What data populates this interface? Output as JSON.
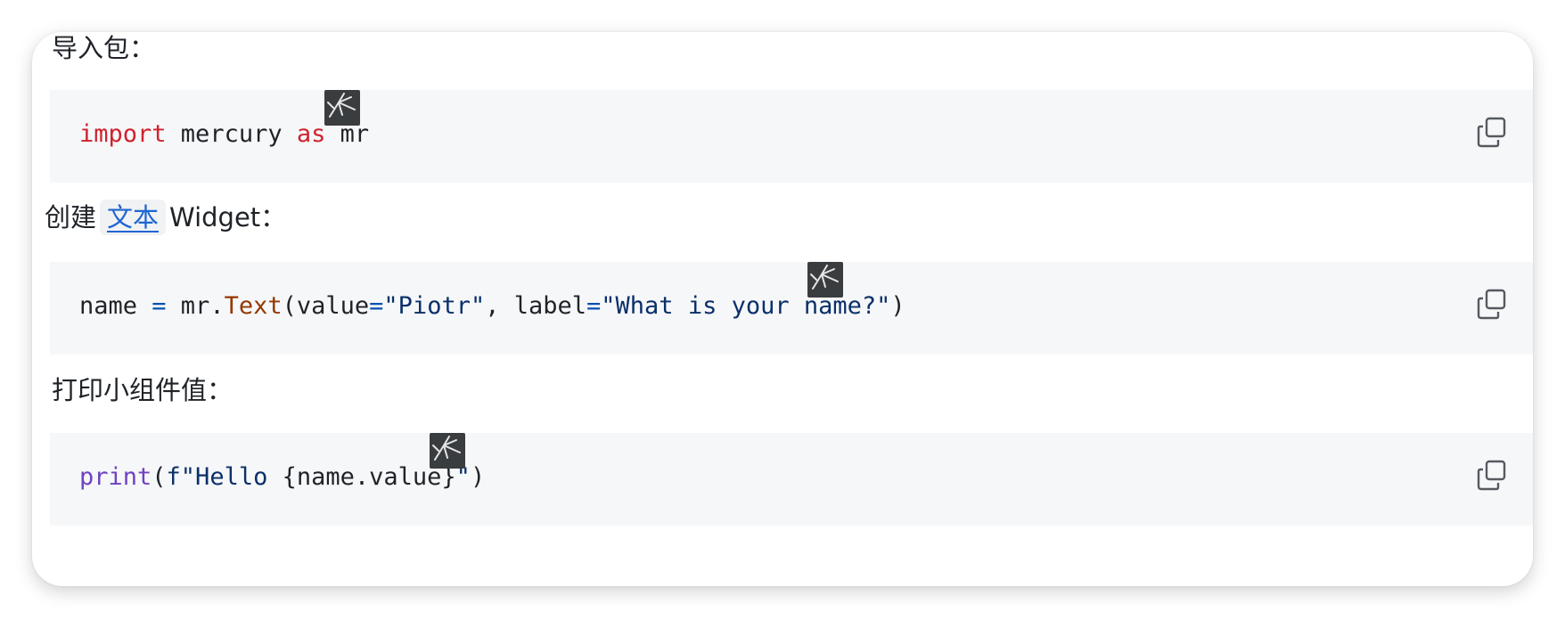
{
  "sections": [
    {
      "label": "导入包：",
      "code": {
        "keyword_import": "import",
        "module": " mercury ",
        "keyword_as": "as",
        "alias": " mr"
      }
    },
    {
      "label_prefix": "创建",
      "link_text": "文本",
      "label_suffix": "Widget：",
      "code": {
        "var": "name ",
        "eq": "=",
        "obj": " mr.",
        "func": "Text",
        "p1": "(value",
        "eq2": "=",
        "s1": "\"Piotr\"",
        "p2": ", label",
        "eq3": "=",
        "s2": "\"What is your name?\"",
        "p3": ")"
      }
    },
    {
      "label": "打印小组件值：",
      "code": {
        "func": "print",
        "p1": "(",
        "fstring": "f\"Hello ",
        "expr": "{name.value}",
        "fend": "\"",
        "p2": ")"
      }
    }
  ],
  "icons": {
    "copy": "copy-icon",
    "feedback": "feedback-icon"
  }
}
